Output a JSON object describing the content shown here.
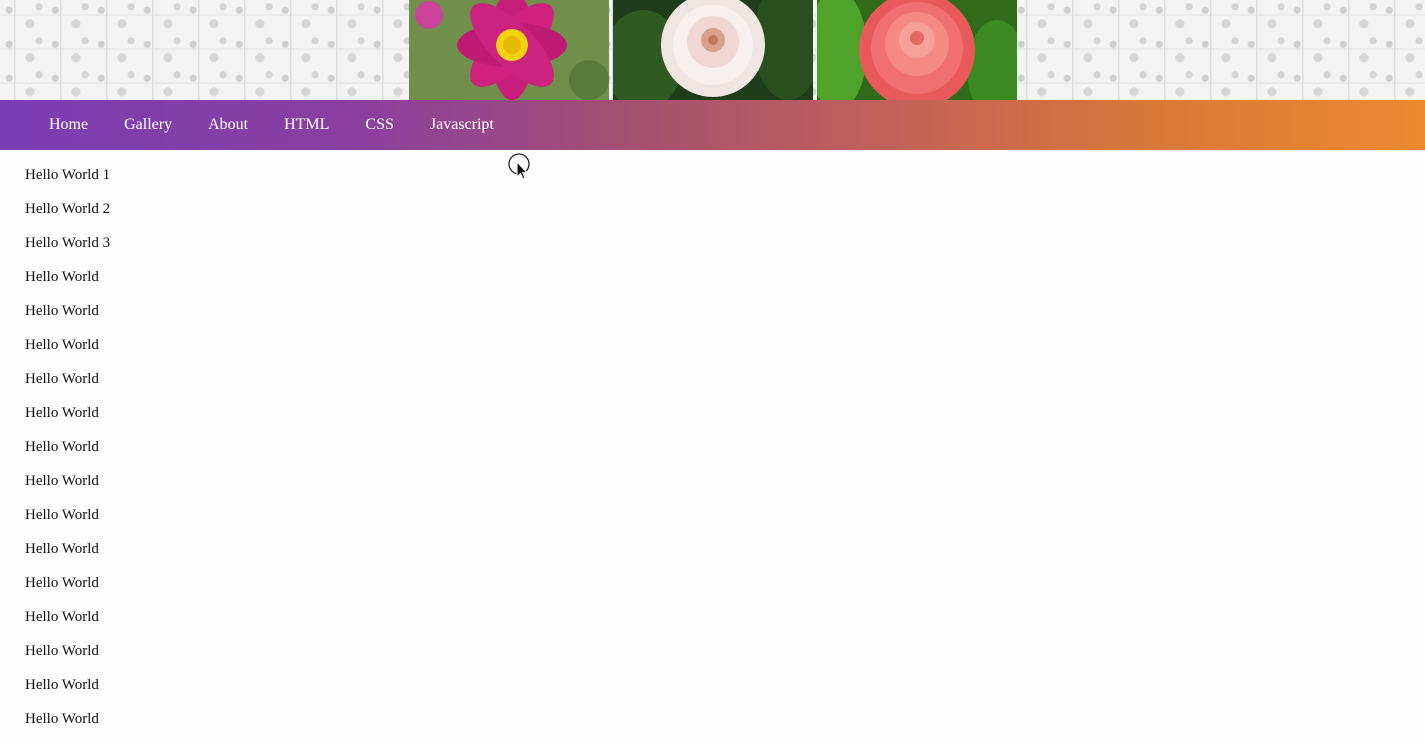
{
  "header": {
    "photos": [
      {
        "name": "pink-cosmos-flower",
        "color": "#c81d7a"
      },
      {
        "name": "white-dahlia-flower",
        "color": "#f2e6e4"
      },
      {
        "name": "coral-dahlia-flower",
        "color": "#f07070"
      }
    ]
  },
  "nav": {
    "items": [
      {
        "label": "Home"
      },
      {
        "label": "Gallery"
      },
      {
        "label": "About"
      },
      {
        "label": "HTML"
      },
      {
        "label": "CSS"
      },
      {
        "label": "Javascript"
      }
    ],
    "gradient": [
      "#7a3db3",
      "#ec8a30"
    ]
  },
  "content": {
    "lines": [
      "Hello World 1",
      "Hello World 2",
      "Hello World 3",
      "Hello World",
      "Hello World",
      "Hello World",
      "Hello World",
      "Hello World",
      "Hello World",
      "Hello World",
      "Hello World",
      "Hello World",
      "Hello World",
      "Hello World",
      "Hello World",
      "Hello World",
      "Hello World"
    ]
  }
}
